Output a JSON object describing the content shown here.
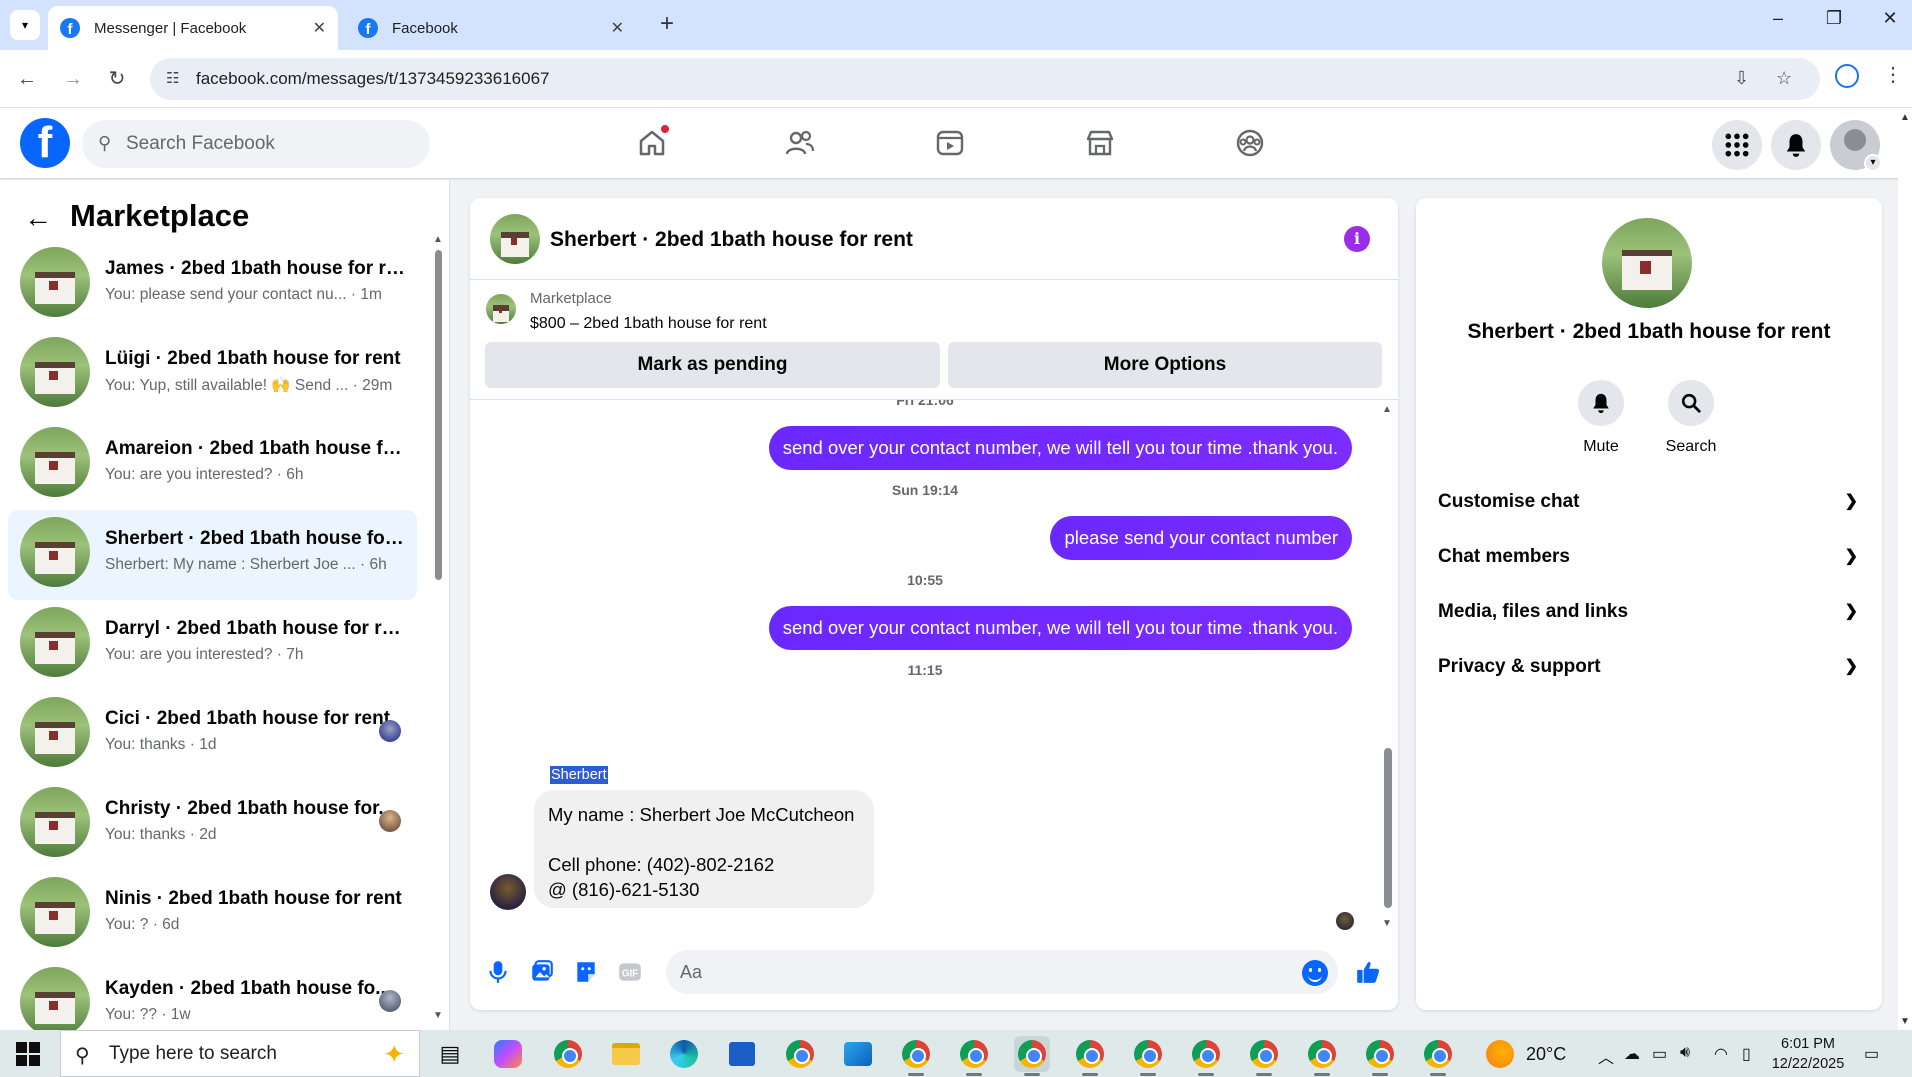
{
  "browser": {
    "tabs": [
      {
        "title": "Messenger | Facebook",
        "active": true
      },
      {
        "title": "Facebook",
        "active": false
      }
    ],
    "url": "facebook.com/messages/t/1373459233616067"
  },
  "facebook": {
    "search_placeholder": "Search Facebook",
    "colors": {
      "brand": "#0866ff",
      "outgoing_bubble": "#7000ff",
      "selected_row": "#ebf5ff"
    }
  },
  "sidebar": {
    "heading": "Marketplace",
    "conversations": [
      {
        "name": "James · 2bed 1bath house for rent",
        "preview": "You: please send your contact nu... · 1m"
      },
      {
        "name": "Lüigi · 2bed 1bath house for rent",
        "preview": "You: Yup, still available! 🙌 Send ... · 29m"
      },
      {
        "name": "Amareion · 2bed 1bath house fo...",
        "preview": "You: are you interested? · 6h"
      },
      {
        "name": "Sherbert · 2bed 1bath house for ...",
        "preview": "Sherbert: My name : Sherbert Joe ... · 6h"
      },
      {
        "name": "Darryl · 2bed 1bath house for rent",
        "preview": "You: are you interested? · 7h"
      },
      {
        "name": "Cici · 2bed 1bath house for rent",
        "preview": "You: thanks · 1d"
      },
      {
        "name": "Christy · 2bed 1bath house for...",
        "preview": "You: thanks · 2d"
      },
      {
        "name": "Ninis · 2bed 1bath house for rent",
        "preview": "You: ? · 6d"
      },
      {
        "name": "Kayden · 2bed 1bath house fo...",
        "preview": "You: ?? · 1w"
      }
    ]
  },
  "chat": {
    "title": "Sherbert · 2bed 1bath house for rent",
    "marketplace_label": "Marketplace",
    "listing": "$800 – 2bed 1bath house for rent",
    "mark_pending_label": "Mark as pending",
    "more_options_label": "More Options",
    "cut_timestamp": "Fri 21:06",
    "messages": [
      {
        "text": "send over your contact number, we will tell you tour time .thank you."
      },
      {
        "timestamp": "Sun 19:14"
      },
      {
        "text": "please send your contact number"
      },
      {
        "timestamp": "10:55"
      },
      {
        "text": "send over your contact number, we will tell you tour time .thank you."
      },
      {
        "timestamp": "11:15"
      }
    ],
    "incoming": {
      "sender": "Sherbert",
      "line1": "My name : Sherbert Joe McCutcheon",
      "line2": "Cell phone: (402)-802-2162",
      "line3": "@ (816)-621-5130"
    },
    "input_placeholder": "Aa"
  },
  "info_panel": {
    "name": "Sherbert · 2bed 1bath house for rent",
    "actions": [
      {
        "label": "Mute",
        "icon": "bell-icon"
      },
      {
        "label": "Search",
        "icon": "search-icon"
      }
    ],
    "sections": [
      "Customise chat",
      "Chat members",
      "Media, files and links",
      "Privacy & support"
    ]
  },
  "taskbar": {
    "search_placeholder": "Type here to search",
    "temperature": "20°C",
    "time": "6:01 PM",
    "date": "12/22/2025"
  }
}
